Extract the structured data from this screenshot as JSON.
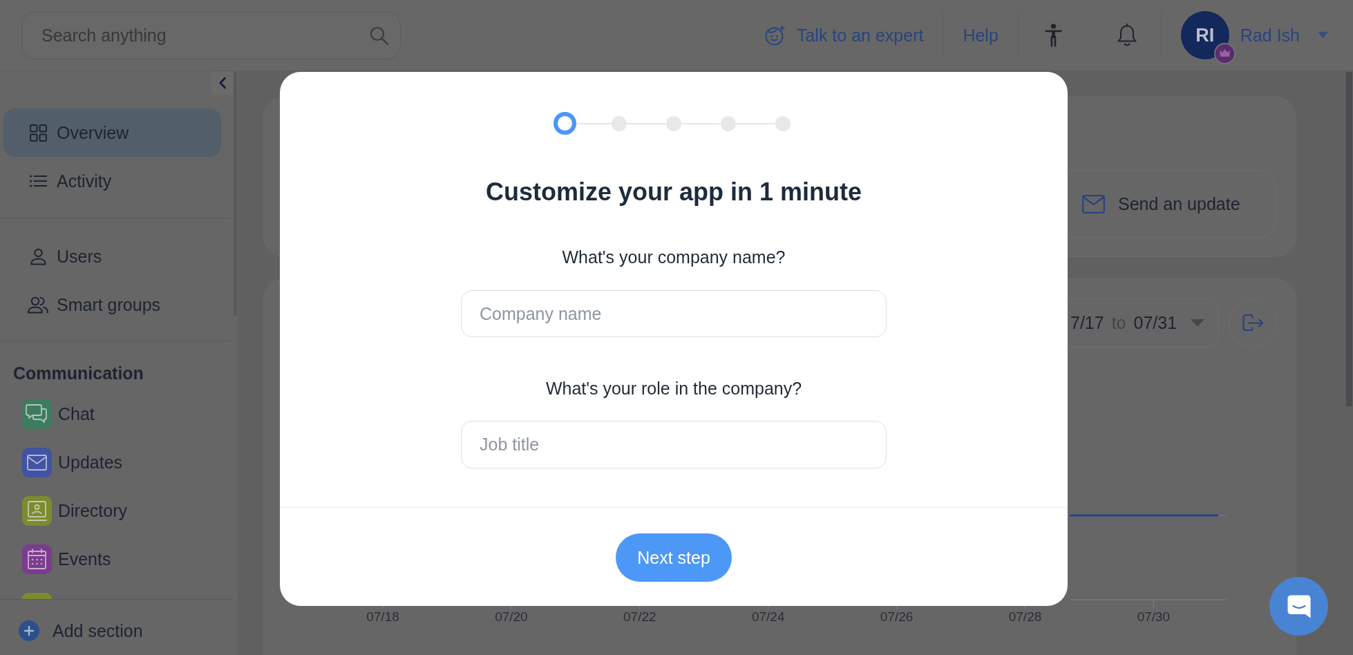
{
  "top_bar": {
    "search": {
      "placeholder": "Search anything"
    },
    "links": [
      {
        "label": "Talk to an expert"
      },
      {
        "label": "Help"
      }
    ],
    "user": {
      "initials": "RI",
      "name": "Rad Ish"
    }
  },
  "sidebar": {
    "groups": [
      {
        "items": [
          {
            "label": "Overview",
            "selected": true
          },
          {
            "label": "Activity",
            "selected": false
          }
        ]
      },
      {
        "items": [
          {
            "label": "Users",
            "selected": false
          },
          {
            "label": "Smart groups",
            "selected": false
          }
        ]
      }
    ],
    "section": {
      "title": "Communication",
      "items": [
        {
          "label": "Chat",
          "color": "#3e7c5f",
          "selected": false
        },
        {
          "label": "Updates",
          "color": "#4253a2",
          "selected": false
        },
        {
          "label": "Directory",
          "color": "#7b8b2f",
          "selected": false
        },
        {
          "label": "Events",
          "color": "#7c3c8d",
          "selected": false
        },
        {
          "color": "#7e8a30"
        }
      ]
    },
    "add_section": {
      "label": "Add section"
    }
  },
  "dashboard": {
    "send_update": {
      "label": "Send an update"
    },
    "date_range": {
      "start": "7/17",
      "separator": "to",
      "end": "07/31"
    },
    "chart": {
      "x_labels": [
        "07/18",
        "07/20",
        "07/22",
        "07/24",
        "07/26",
        "07/28",
        "07/30"
      ]
    }
  },
  "modal": {
    "steps": [
      {
        "selected": true
      },
      {
        "selected": false
      },
      {
        "selected": false
      },
      {
        "selected": false
      },
      {
        "selected": false
      }
    ],
    "title": "Customize your app in 1 minute",
    "fields": [
      {
        "question": "What's your company name?",
        "placeholder": "Company name"
      },
      {
        "question": "What's your role in the company?",
        "placeholder": "Job title"
      }
    ],
    "button": {
      "label": "Next step"
    }
  }
}
